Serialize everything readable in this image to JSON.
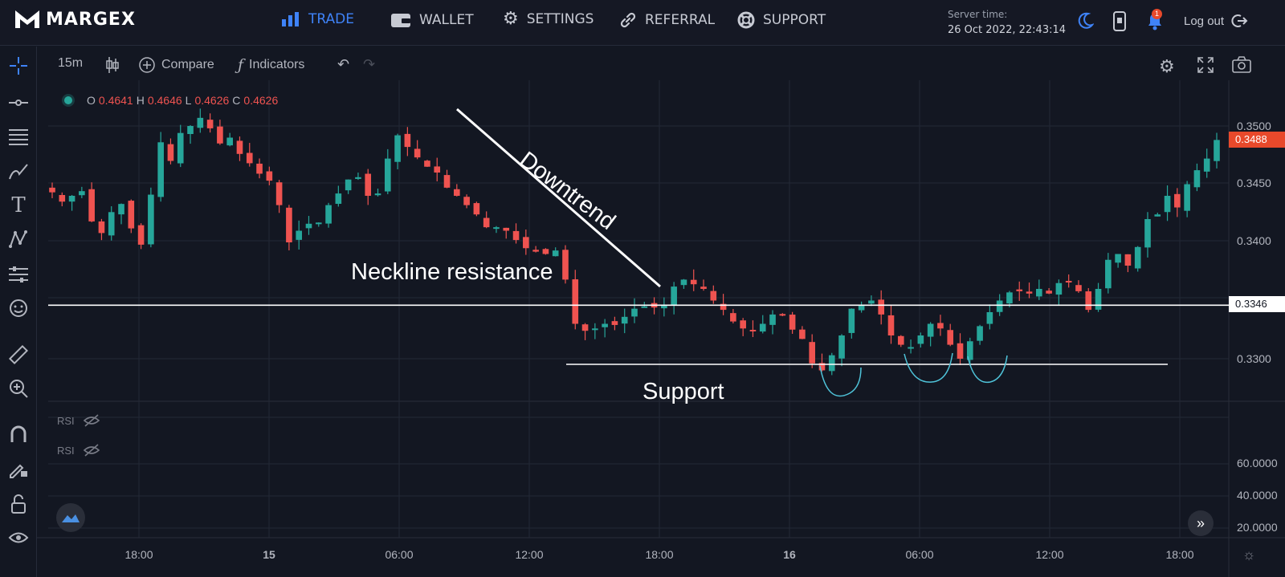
{
  "brand": {
    "name": "MARGEX"
  },
  "nav": [
    {
      "label": "TRADE",
      "icon": "bar-chart-icon",
      "active": true
    },
    {
      "label": "WALLET",
      "icon": "wallet-icon",
      "active": false
    },
    {
      "label": "SETTINGS",
      "icon": "gear-icon",
      "active": false
    },
    {
      "label": "REFERRAL",
      "icon": "link-icon",
      "active": false
    },
    {
      "label": "SUPPORT",
      "icon": "lifebuoy-icon",
      "active": false
    }
  ],
  "server": {
    "label": "Server time:",
    "value": "26 Oct 2022, 22:43:14"
  },
  "notifications": {
    "count": "1"
  },
  "logout": {
    "label": "Log out"
  },
  "toolbar": {
    "interval": "15m",
    "compare": "Compare",
    "indicators": "Indicators"
  },
  "ohlc": {
    "o_label": "O",
    "o": "0.4641",
    "h_label": "H",
    "h": "0.4646",
    "l_label": "L",
    "l": "0.4626",
    "c_label": "C",
    "c": "0.4626"
  },
  "indicators": [
    {
      "label": "RSI"
    },
    {
      "label": "RSI"
    }
  ],
  "annotations": {
    "downtrend": "Downtrend",
    "neckline": "Neckline resistance",
    "support": "Support"
  },
  "colors": {
    "up": "#26a69a",
    "down": "#ef5350",
    "accent": "#3f83f8",
    "background": "#131722",
    "grid": "#232836",
    "brand_red": "#e8492b"
  },
  "chart_data": {
    "type": "candlestick",
    "price_axis": {
      "ticks": [
        "0.3500",
        "0.3450",
        "0.3400",
        "0.3300"
      ],
      "current_price": "0.3488",
      "marked_level": "0.3346"
    },
    "rsi_axis": {
      "ticks": [
        "60.0000",
        "40.0000",
        "20.0000"
      ]
    },
    "time_axis": {
      "ticks": [
        "18:00",
        "15",
        "06:00",
        "12:00",
        "18:00",
        "16",
        "06:00",
        "12:00",
        "18:00"
      ]
    },
    "lines": {
      "neckline_resistance": 0.3346,
      "support": 0.3293
    },
    "close_path": [
      0.3443,
      0.3435,
      0.344,
      0.3444,
      0.3418,
      0.3408,
      0.3426,
      0.3433,
      0.3412,
      0.3398,
      0.3441,
      0.3486,
      0.347,
      0.3494,
      0.35,
      0.3507,
      0.3498,
      0.3485,
      0.349,
      0.3476,
      0.3468,
      0.3459,
      0.3453,
      0.3432,
      0.34,
      0.341,
      0.3416,
      0.3417,
      0.3432,
      0.3442,
      0.3454,
      0.3456,
      0.344,
      0.3442,
      0.3472,
      0.3492,
      0.3482,
      0.3473,
      0.3465,
      0.346,
      0.3447,
      0.344,
      0.3432,
      0.3424,
      0.3413,
      0.3413,
      0.341,
      0.3402,
      0.3395,
      0.3392,
      0.339,
      0.3393,
      0.3368,
      0.333,
      0.3324,
      0.3326,
      0.333,
      0.3329,
      0.3336,
      0.3343,
      0.3345,
      0.3344,
      0.3346,
      0.3362,
      0.3368,
      0.3364,
      0.336,
      0.335,
      0.3342,
      0.3332,
      0.3326,
      0.3324,
      0.333,
      0.3338,
      0.3338,
      0.3325,
      0.3317,
      0.3296,
      0.329,
      0.3303,
      0.332,
      0.3343,
      0.3346,
      0.335,
      0.3338,
      0.332,
      0.3312,
      0.331,
      0.332,
      0.333,
      0.3326,
      0.3312,
      0.33,
      0.3315,
      0.3328,
      0.334,
      0.335,
      0.3357,
      0.3358,
      0.3356,
      0.336,
      0.3356,
      0.3365,
      0.3366,
      0.3358,
      0.3342,
      0.336,
      0.3385,
      0.339,
      0.338,
      0.3396,
      0.342,
      0.3424,
      0.344,
      0.343,
      0.345,
      0.3462,
      0.3472,
      0.3488
    ]
  }
}
